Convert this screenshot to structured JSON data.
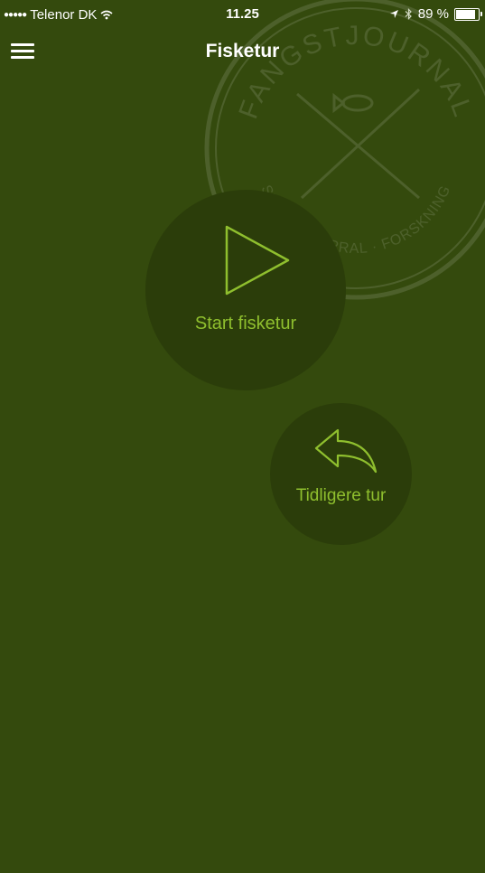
{
  "status_bar": {
    "signal": "●●●●●",
    "carrier": "Telenor DK",
    "wifi": "wifi-icon",
    "time": "11.25",
    "battery_text": "89 %",
    "battery_level": 0.89
  },
  "nav": {
    "title": "Fisketur",
    "menu_icon": "hamburger-menu-icon"
  },
  "watermark": {
    "top_text": "FANGSTJOURNAL",
    "bottom_text": "SUNDHED · PRAL · FORSKNING"
  },
  "actions": {
    "start_label": "Start fisketur",
    "start_icon": "play-icon",
    "previous_label": "Tidligere tur",
    "previous_icon": "reply-arrow-icon"
  },
  "colors": {
    "background": "#344a0d",
    "circle": "#2b3d0a",
    "accent": "#8fbf2e"
  }
}
